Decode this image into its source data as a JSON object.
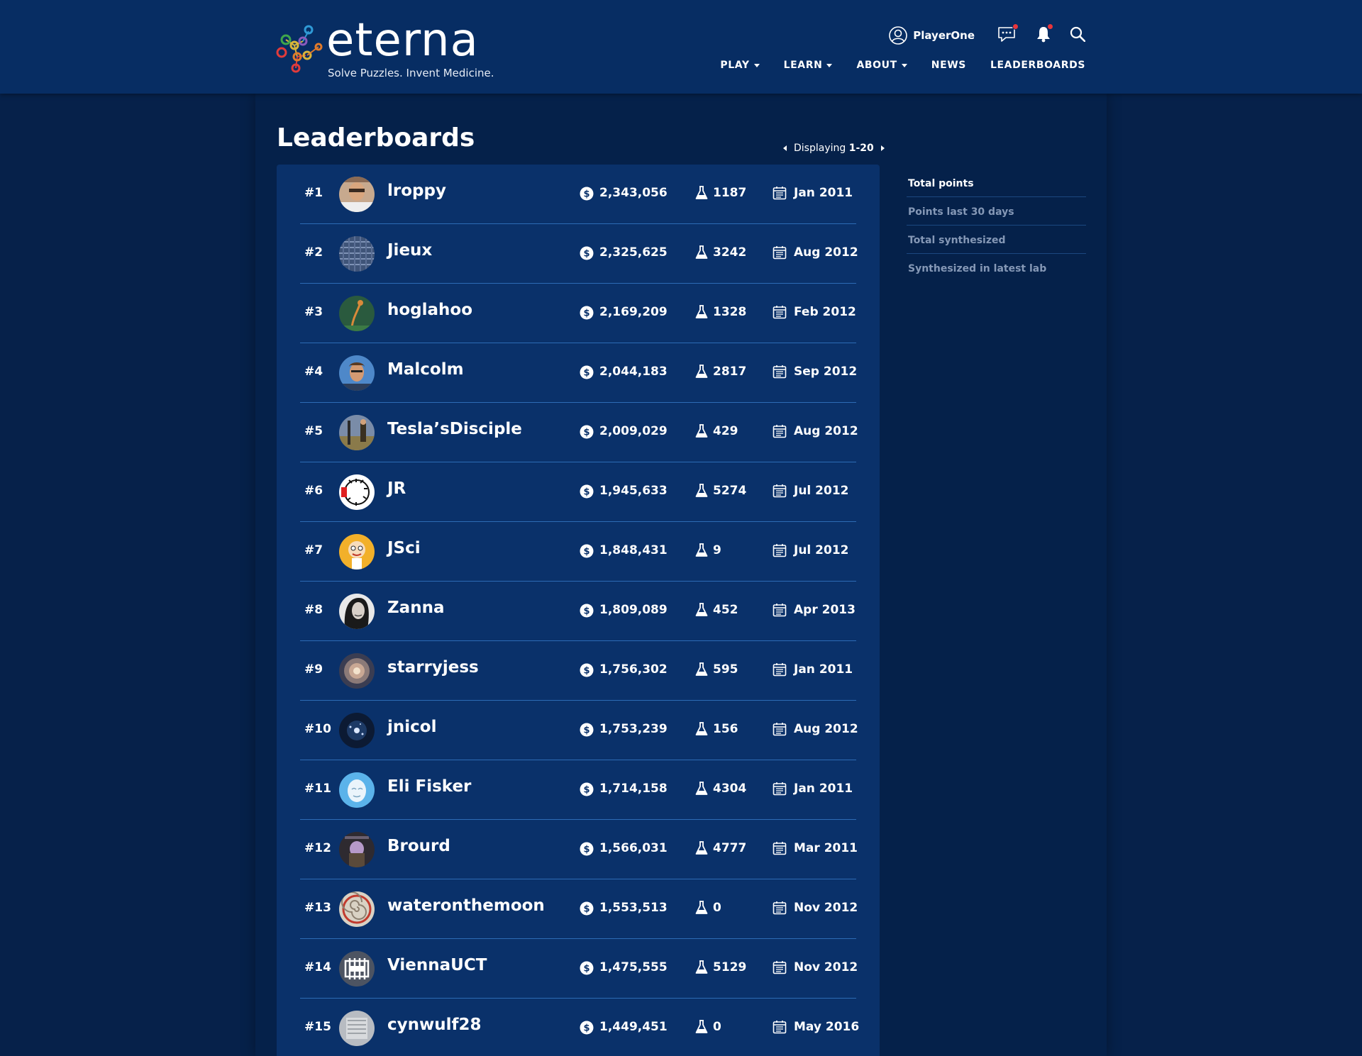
{
  "brand": {
    "name": "eterna",
    "tagline": "Solve Puzzles. Invent Medicine.",
    "colors": {
      "header_bg": "#072d63",
      "page_bg": "#05214a",
      "board_bg": "#0a316a",
      "divider": "#2d6bb5",
      "notification": "#e8353b"
    }
  },
  "header": {
    "username": "PlayerOne",
    "icons": [
      "user-icon",
      "chat-icon",
      "bell-icon",
      "search-icon"
    ],
    "nav": [
      {
        "label": "PLAY",
        "dropdown": true
      },
      {
        "label": "LEARN",
        "dropdown": true
      },
      {
        "label": "ABOUT",
        "dropdown": true
      },
      {
        "label": "NEWS",
        "dropdown": false
      },
      {
        "label": "LEADERBOARDS",
        "dropdown": false
      }
    ]
  },
  "main": {
    "title": "Leaderboards",
    "pager": {
      "prefix": "Displaying",
      "range": "1-20"
    },
    "rows": [
      {
        "rank": "#1",
        "name": "lroppy",
        "points": "2,343,056",
        "synth": "1187",
        "joined": "Jan 2011"
      },
      {
        "rank": "#2",
        "name": "Jieux",
        "points": "2,325,625",
        "synth": "3242",
        "joined": "Aug 2012"
      },
      {
        "rank": "#3",
        "name": "hoglahoo",
        "points": "2,169,209",
        "synth": "1328",
        "joined": "Feb 2012"
      },
      {
        "rank": "#4",
        "name": "Malcolm",
        "points": "2,044,183",
        "synth": "2817",
        "joined": "Sep 2012"
      },
      {
        "rank": "#5",
        "name": "Tesla’sDisciple",
        "points": "2,009,029",
        "synth": "429",
        "joined": "Aug 2012"
      },
      {
        "rank": "#6",
        "name": "JR",
        "points": "1,945,633",
        "synth": "5274",
        "joined": "Jul 2012"
      },
      {
        "rank": "#7",
        "name": "JSci",
        "points": "1,848,431",
        "synth": "9",
        "joined": "Jul 2012"
      },
      {
        "rank": "#8",
        "name": "Zanna",
        "points": "1,809,089",
        "synth": "452",
        "joined": "Apr 2013"
      },
      {
        "rank": "#9",
        "name": "starryjess",
        "points": "1,756,302",
        "synth": "595",
        "joined": "Jan 2011"
      },
      {
        "rank": "#10",
        "name": "jnicol",
        "points": "1,753,239",
        "synth": "156",
        "joined": "Aug 2012"
      },
      {
        "rank": "#11",
        "name": "Eli Fisker",
        "points": "1,714,158",
        "synth": "4304",
        "joined": "Jan 2011"
      },
      {
        "rank": "#12",
        "name": "Brourd",
        "points": "1,566,031",
        "synth": "4777",
        "joined": "Mar 2011"
      },
      {
        "rank": "#13",
        "name": "wateronthemoon",
        "points": "1,553,513",
        "synth": "0",
        "joined": "Nov 2012"
      },
      {
        "rank": "#14",
        "name": "ViennaUCT",
        "points": "1,475,555",
        "synth": "5129",
        "joined": "Nov 2012"
      },
      {
        "rank": "#15",
        "name": "cynwulf28",
        "points": "1,449,451",
        "synth": "0",
        "joined": "May 2016"
      }
    ]
  },
  "sidebar": {
    "items": [
      {
        "label": "Total points",
        "active": true
      },
      {
        "label": "Points last 30 days",
        "active": false
      },
      {
        "label": "Total synthesized",
        "active": false
      },
      {
        "label": "Synthesized in latest lab",
        "active": false
      }
    ]
  }
}
